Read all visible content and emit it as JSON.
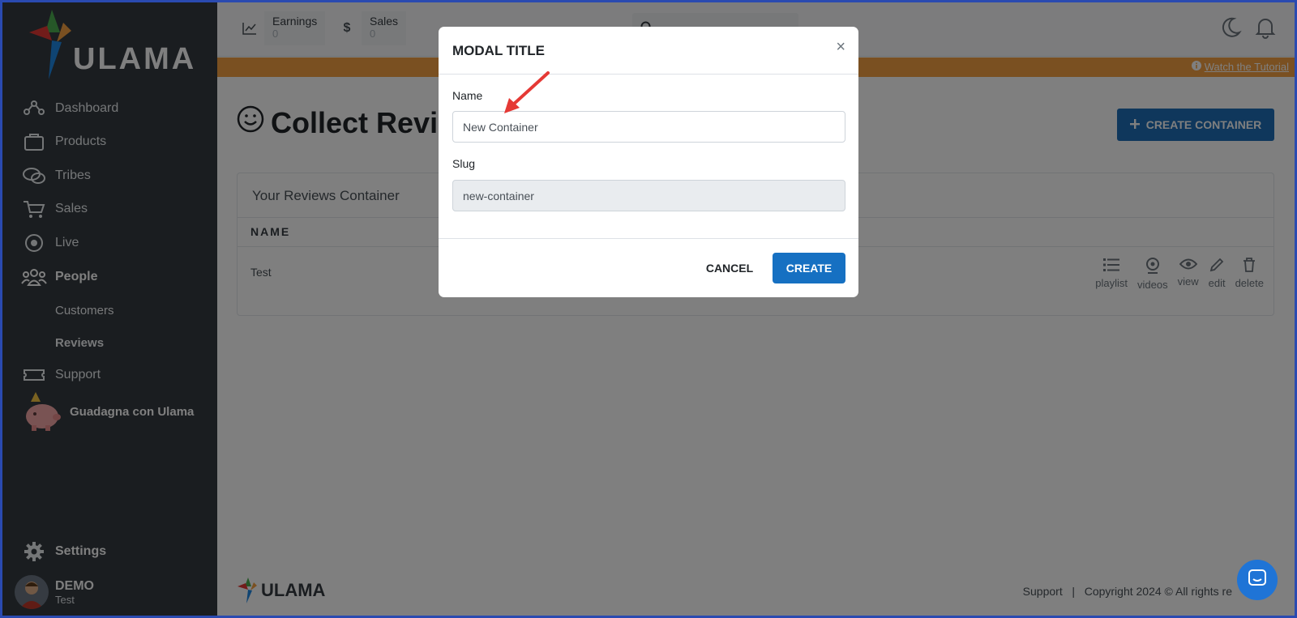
{
  "sidebar": {
    "brand": "ULAMA",
    "items": [
      {
        "label": "Dashboard",
        "icon": "dashboard-icon"
      },
      {
        "label": "Products",
        "icon": "products-icon"
      },
      {
        "label": "Tribes",
        "icon": "tribes-icon"
      },
      {
        "label": "Sales",
        "icon": "cart-icon"
      },
      {
        "label": "Live",
        "icon": "live-icon"
      },
      {
        "label": "People",
        "icon": "people-icon"
      },
      {
        "label": "Support",
        "icon": "ticket-icon"
      }
    ],
    "sub_items": [
      {
        "label": "Customers"
      },
      {
        "label": "Reviews"
      }
    ],
    "promo": "Guadagna con Ulama",
    "settings": "Settings",
    "user": {
      "name": "DEMO",
      "role": "Test"
    }
  },
  "topbar": {
    "earnings_label": "Earnings",
    "earnings_value": "0",
    "sales_label": "Sales",
    "sales_value": "0"
  },
  "banner": {
    "tutorial": "Watch the Tutorial"
  },
  "main": {
    "title": "Collect Revie",
    "create_button": "CREATE CONTAINER",
    "card_title": "Your Reviews Container",
    "column_name": "NAME",
    "rows": [
      {
        "name": "Test"
      }
    ],
    "actions": [
      "playlist",
      "videos",
      "view",
      "edit",
      "delete"
    ]
  },
  "footer": {
    "brand": "ULAMA",
    "support": "Support",
    "separator": "|",
    "copyright": "Copyright 2024 © All rights re"
  },
  "modal": {
    "title": "MODAL TITLE",
    "close": "×",
    "name_label": "Name",
    "name_value": "New Container",
    "slug_label": "Slug",
    "slug_value": "new-container",
    "cancel": "CANCEL",
    "create": "CREATE"
  },
  "colors": {
    "sidebar": "#343a40",
    "banner": "#f5a142",
    "primary": "#1670c2",
    "annotation_arrow": "#e53935"
  }
}
